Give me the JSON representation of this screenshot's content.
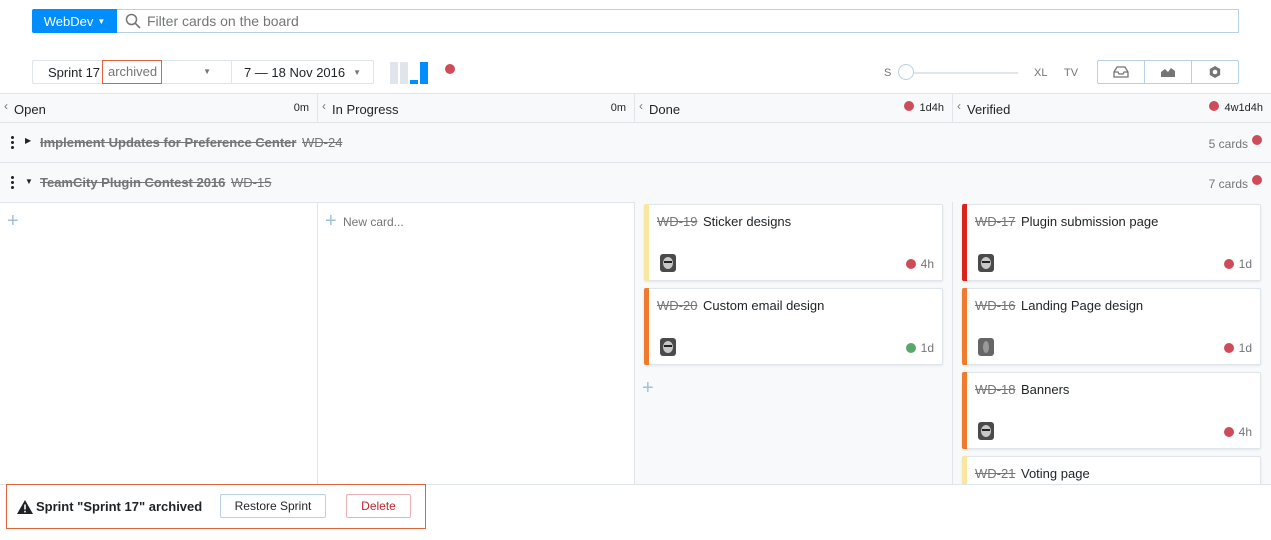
{
  "search": {
    "project": "WebDev",
    "placeholder": "Filter cards on the board"
  },
  "sprint": {
    "name": "Sprint 17",
    "state": "archived",
    "dates": "7 — 18 Nov 2016"
  },
  "size_slider": {
    "min_label": "S",
    "max_label": "XL",
    "tv_label": "TV",
    "value": 0
  },
  "view_buttons": [
    "inbox-icon",
    "chart-icon",
    "settings-icon"
  ],
  "columns": [
    {
      "name": "Open",
      "time": "0m",
      "has_dot": false
    },
    {
      "name": "In Progress",
      "time": "0m",
      "has_dot": false
    },
    {
      "name": "Done",
      "time": "1d4h",
      "has_dot": true
    },
    {
      "name": "Verified",
      "time": "4w1d4h",
      "has_dot": true
    }
  ],
  "swimlanes": [
    {
      "title": "Implement Updates for Preference Center",
      "id": "WD-24",
      "count": "5 cards",
      "expanded": false
    },
    {
      "title": "TeamCity Plugin Contest 2016",
      "id": "WD-15",
      "count": "7 cards",
      "expanded": true
    }
  ],
  "new_card_label": "New card...",
  "cards": {
    "done": [
      {
        "id": "WD-19",
        "summary": "Sticker designs",
        "estimate": "4h",
        "stripe": "#f9e6a0",
        "dot": "#ce4c5a"
      },
      {
        "id": "WD-20",
        "summary": "Custom email design",
        "estimate": "1d",
        "stripe": "#f07b2f",
        "dot": "#59a869"
      }
    ],
    "verified": [
      {
        "id": "WD-17",
        "summary": "Plugin submission page",
        "estimate": "1d",
        "stripe": "#d9231e",
        "dot": "#ce4c5a"
      },
      {
        "id": "WD-16",
        "summary": "Landing Page design",
        "estimate": "1d",
        "stripe": "#f07b2f",
        "dot": "#ce4c5a"
      },
      {
        "id": "WD-18",
        "summary": "Banners",
        "estimate": "4h",
        "stripe": "#f07b2f",
        "dot": "#ce4c5a"
      },
      {
        "id": "WD-21",
        "summary": "Voting page",
        "estimate": "",
        "stripe": "#f9e6a0",
        "dot": ""
      }
    ]
  },
  "notice": {
    "message": "Sprint \"Sprint 17\" archived",
    "restore_label": "Restore Sprint",
    "delete_label": "Delete"
  },
  "colors": {
    "accent": "#008eff",
    "warning_border": "#e0643a",
    "status_red": "#ce4c5a",
    "status_green": "#59a869"
  }
}
